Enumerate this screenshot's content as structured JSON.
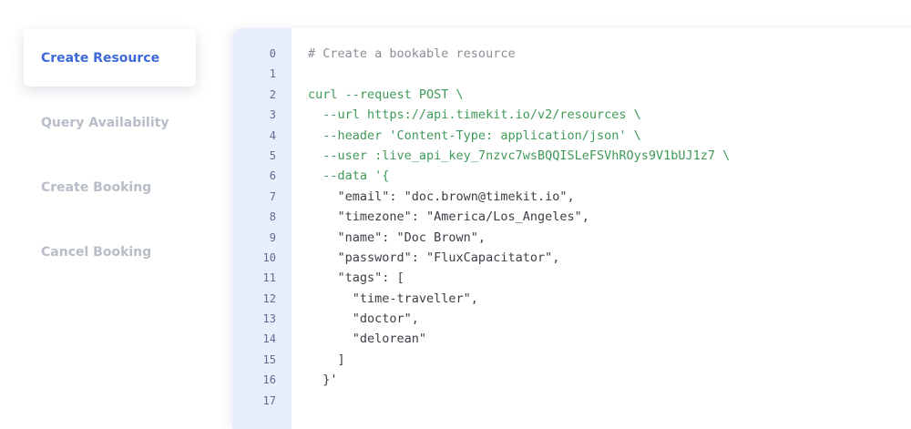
{
  "nav": {
    "items": [
      {
        "label": "Create Resource",
        "active": true
      },
      {
        "label": "Query Availability",
        "active": false
      },
      {
        "label": "Create Booking",
        "active": false
      },
      {
        "label": "Cancel Booking",
        "active": false
      }
    ]
  },
  "code": {
    "line_numbers": [
      "0",
      "1",
      "2",
      "3",
      "4",
      "5",
      "6",
      "7",
      "8",
      "9",
      "10",
      "11",
      "12",
      "13",
      "14",
      "15",
      "16",
      "17"
    ],
    "lines": [
      {
        "text": "# Create a bookable resource",
        "kind": "comment"
      },
      {
        "text": "",
        "kind": "cmd"
      },
      {
        "text": "curl --request POST \\",
        "kind": "cmd"
      },
      {
        "text": "  --url https://api.timekit.io/v2/resources \\",
        "kind": "cmd"
      },
      {
        "text": "  --header 'Content-Type: application/json' \\",
        "kind": "cmd"
      },
      {
        "text": "  --user :live_api_key_7nzvc7wsBQQISLeFSVhROys9V1bUJ1z7 \\",
        "kind": "cmd"
      },
      {
        "text": "  --data '{",
        "kind": "cmd"
      },
      {
        "text": "    \"email\": \"doc.brown@timekit.io\",",
        "kind": "str"
      },
      {
        "text": "    \"timezone\": \"America/Los_Angeles\",",
        "kind": "str"
      },
      {
        "text": "    \"name\": \"Doc Brown\",",
        "kind": "str"
      },
      {
        "text": "    \"password\": \"FluxCapacitator\",",
        "kind": "str"
      },
      {
        "text": "    \"tags\": [",
        "kind": "str"
      },
      {
        "text": "      \"time-traveller\",",
        "kind": "str"
      },
      {
        "text": "      \"doctor\",",
        "kind": "str"
      },
      {
        "text": "      \"delorean\"",
        "kind": "str"
      },
      {
        "text": "    ]",
        "kind": "str"
      },
      {
        "text": "  }'",
        "kind": "str"
      },
      {
        "text": "",
        "kind": "str"
      }
    ]
  },
  "colors": {
    "accent": "#3e6ad9",
    "nav_inactive": "#b7bec7",
    "gutter_bg": "#e9eefc",
    "comment": "#8b8f96",
    "command": "#3f9a58",
    "json_text": "#3a3e45"
  }
}
